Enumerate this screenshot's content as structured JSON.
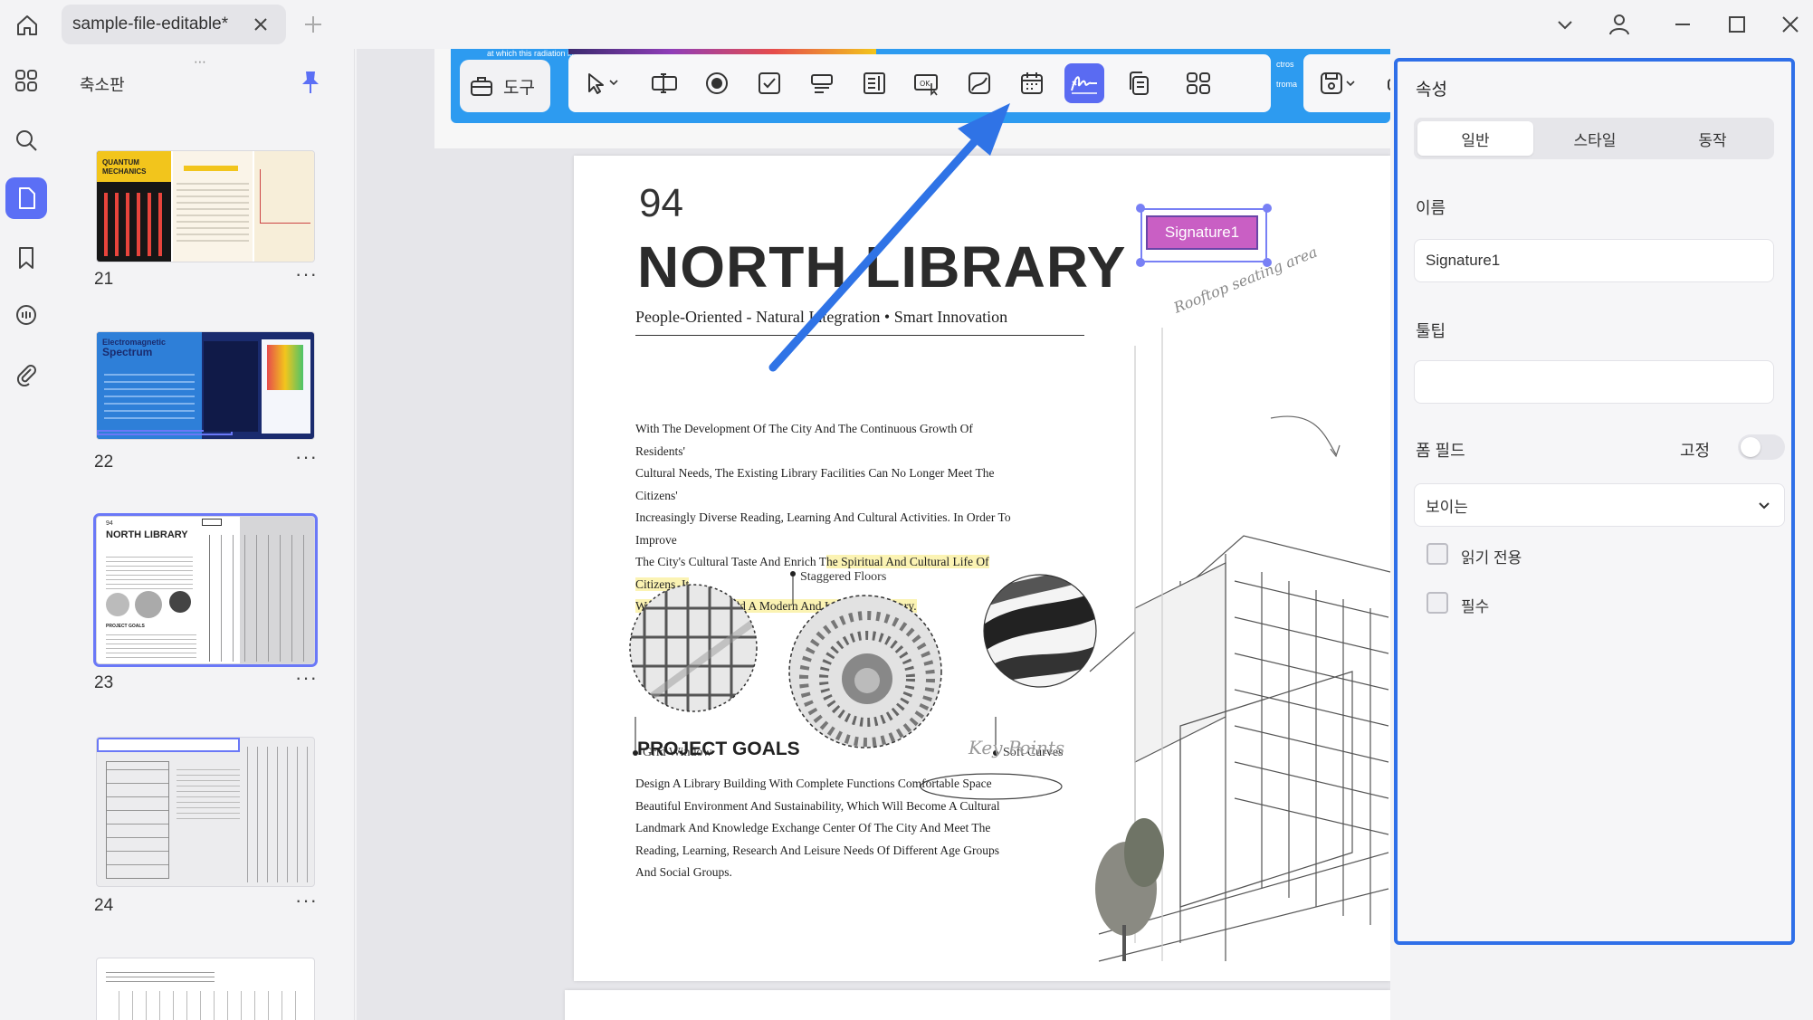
{
  "tab": {
    "title": "sample-file-editable*"
  },
  "thumbnails": {
    "title": "축소판",
    "pages": [
      {
        "number": "21"
      },
      {
        "number": "22"
      },
      {
        "number": "23"
      },
      {
        "number": "24"
      }
    ],
    "more": "···",
    "thumb21": {
      "line1": "QUANTUM",
      "line2": "MECHANICS"
    },
    "thumb22": {
      "line1": "Electromagnetic",
      "line2": "Spectrum"
    },
    "thumb23": {
      "num": "94",
      "title": "NORTH LIBRARY",
      "goals": "PROJECT GOALS"
    }
  },
  "toolbar": {
    "tools_label": "도구",
    "band_text_left": "at which this radiation is",
    "band_text_right1": "ctros",
    "band_text_right2": "troma"
  },
  "document": {
    "page_number": "94",
    "title": "NORTH LIBRARY",
    "subtitle": "People-Oriented - Natural Integration • Smart Innovation",
    "intro_lines": [
      "With The Development Of The City And The Continuous Growth Of Residents'",
      "Cultural Needs, The Existing Library Facilities Can No Longer Meet The Citizens'",
      "Increasingly Diverse Reading, Learning And Cultural Activities. In Order To Improve"
    ],
    "intro_line4_plain": "The City's Cultural Taste And Enrich T",
    "intro_line4_hl": "he Spiritual And Cultural Life Of Citizens, It",
    "intro_line5_hl": "Was Decided To Build A Modern And Intelligent Library.",
    "labels": {
      "staggered": "Staggered Floors",
      "grid": "Grid Window",
      "soft": "Soft Curves"
    },
    "rooftop": "Rooftop seating area",
    "goals_heading": "PROJECT GOALS",
    "key_points": "Key Points",
    "goals_lines": [
      "Design A Library Building With Complete Functions Comfortable Space",
      "Beautiful Environment And Sustainability, Which Will Become A Cultural",
      "Landmark And Knowledge Exchange Center Of The City And Meet The",
      "Reading, Learning, Research And Leisure Needs Of Different Age Groups",
      "And Social Groups."
    ],
    "signature_field": "Signature1"
  },
  "properties": {
    "title": "속성",
    "tabs": [
      "일반",
      "스타일",
      "동작"
    ],
    "name_label": "이름",
    "name_value": "Signature1",
    "tooltip_label": "툴팁",
    "tooltip_value": "",
    "form_field_label": "폼 필드",
    "fixed_label": "고정",
    "visibility_value": "보이는",
    "readonly_label": "읽기 전용",
    "required_label": "필수"
  },
  "colors": {
    "accent": "#5b6ff5",
    "panel_border": "#2f6fe8",
    "toolbar_band": "#2d9bf0",
    "signature_fill": "#c95fc4",
    "arrow": "#2f73e6"
  }
}
